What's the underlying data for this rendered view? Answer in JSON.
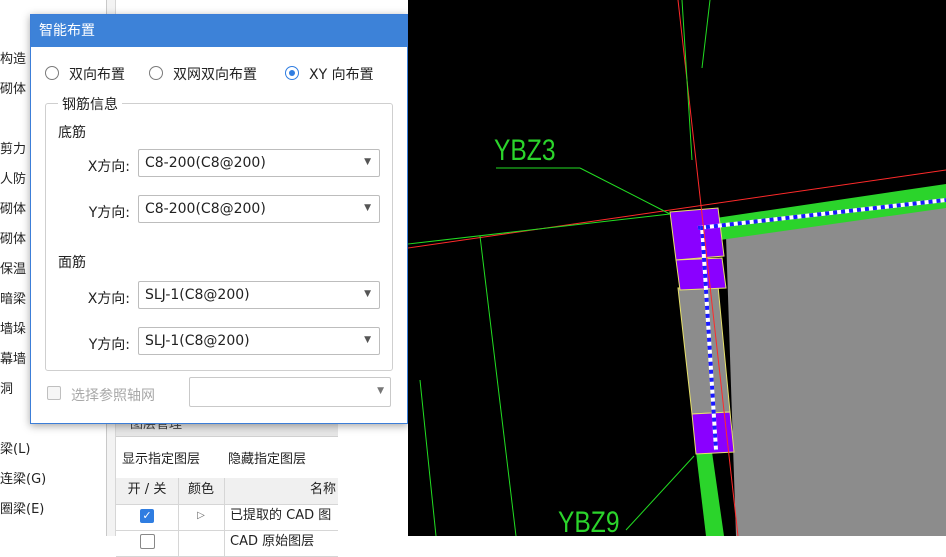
{
  "sidebar": {
    "items": [
      "构造",
      "砌体",
      "剪力",
      "人防",
      "砌体",
      "砌体",
      "保温",
      "暗梁",
      "墙垛",
      "幕墙",
      "洞",
      "梁(L)",
      "连梁(G)",
      "圈梁(E)"
    ]
  },
  "midpanel": {
    "close_glyph": "×",
    "layer_title": "图层管理",
    "show_layer": "显示指定图层",
    "hide_layer": "隐藏指定图层",
    "table": {
      "headers": [
        "开 / 关",
        "颜色",
        "名称"
      ],
      "rows": [
        {
          "checked": true,
          "color_glyph": "▷",
          "name": "已提取的 CAD 图"
        },
        {
          "checked": false,
          "color_glyph": "",
          "name": "CAD 原始图层"
        }
      ]
    }
  },
  "dialog": {
    "title": "智能布置",
    "radios": [
      {
        "label": "双向布置",
        "selected": false
      },
      {
        "label": "双网双向布置",
        "selected": false
      },
      {
        "label": "XY 向布置",
        "selected": true
      }
    ],
    "group_title": "钢筋信息",
    "bottom": {
      "section_label": "底筋",
      "x_label": "X方向:",
      "x_value": "C8-200(C8@200)",
      "y_label": "Y方向:",
      "y_value": "C8-200(C8@200)"
    },
    "top": {
      "section_label": "面筋",
      "x_label": "X方向:",
      "x_value": "SLJ-1(C8@200)",
      "y_label": "Y方向:",
      "y_value": "SLJ-1(C8@200)"
    },
    "ref_grid_label": "选择参照轴网",
    "ref_grid_value": "",
    "dropdown_glyph": "▼"
  },
  "canvas": {
    "labels": [
      "YBZ3",
      "YBZ9"
    ],
    "colors": {
      "background": "#000000",
      "wall": "#2bd42b",
      "column": "#8a00ff",
      "slab": "#8c8c8c",
      "axis": "#ff2a2a",
      "leader": "#22dd22"
    }
  }
}
